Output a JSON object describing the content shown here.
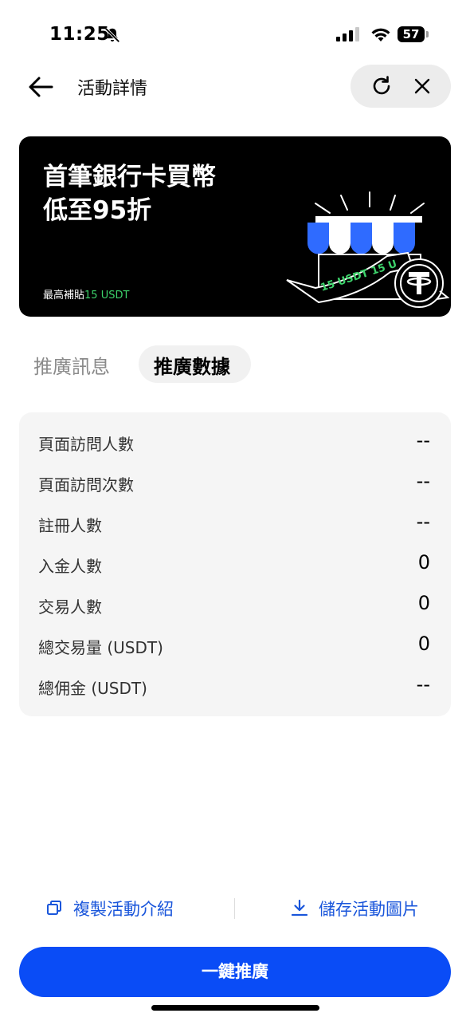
{
  "status_bar": {
    "time": "11:25",
    "battery": "57"
  },
  "nav": {
    "title": "活動詳情"
  },
  "banner": {
    "headline_line1": "首筆銀行卡買幣",
    "headline_line2": "低至95折",
    "subsidy_label": "最高補貼",
    "subsidy_value": "15 USDT",
    "ribbon_text": "15 USDT 15 U",
    "colors": {
      "accent_green": "#3dd36b",
      "awning_blue": "#2f6bff"
    }
  },
  "tabs": [
    {
      "label": "推廣訊息",
      "active": false
    },
    {
      "label": "推廣數據",
      "active": true
    }
  ],
  "stats": [
    {
      "label": "頁面訪問人數",
      "value": "--"
    },
    {
      "label": "頁面訪問次數",
      "value": "--"
    },
    {
      "label": "註冊人數",
      "value": "--"
    },
    {
      "label": "入金人數",
      "value": "0"
    },
    {
      "label": "交易人數",
      "value": "0"
    },
    {
      "label": "總交易量 (USDT)",
      "value": "0"
    },
    {
      "label": "總佣金 (USDT)",
      "value": "--"
    }
  ],
  "actions": {
    "copy_label": "複製活動介紹",
    "save_label": "儲存活動圖片",
    "primary_label": "一鍵推廣"
  },
  "colors": {
    "primary": "#0a4cf6",
    "link": "#1a56db"
  },
  "icons": [
    "bell-slash-icon",
    "signal-icon",
    "wifi-icon",
    "battery-icon",
    "back-arrow-icon",
    "refresh-icon",
    "close-icon",
    "copy-icon",
    "download-icon",
    "tether-icon"
  ]
}
